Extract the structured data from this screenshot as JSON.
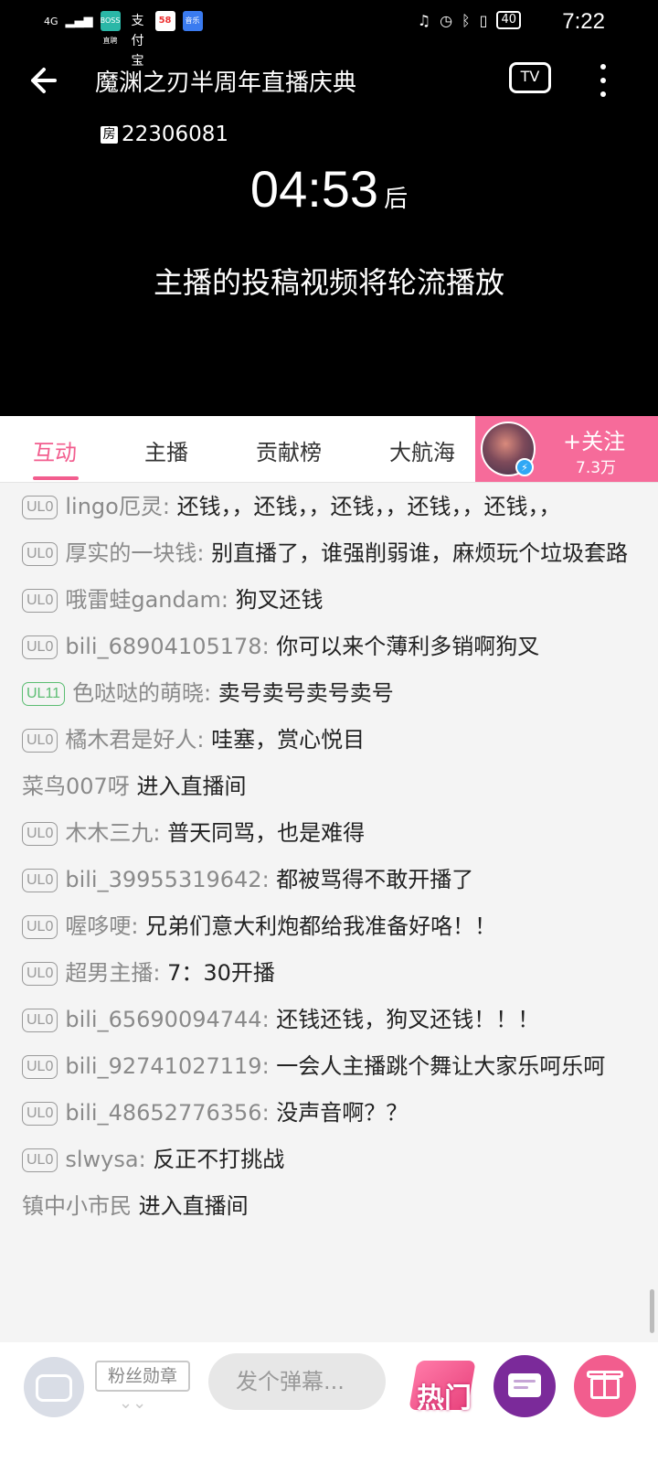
{
  "status_bar": {
    "network": "4G",
    "app_icons": [
      "BOSS直聘",
      "支付宝",
      "58",
      "音乐"
    ],
    "battery": "40",
    "time": "7:22"
  },
  "header": {
    "title": "魔渊之刃半周年直播庆典",
    "tv_label": "TV",
    "room_prefix": "房",
    "room_id": "22306081"
  },
  "player": {
    "countdown": "04:53",
    "countdown_suffix": "后",
    "notice": "主播的投稿视频将轮流播放"
  },
  "tabs": [
    {
      "label": "互动",
      "active": true
    },
    {
      "label": "主播",
      "active": false
    },
    {
      "label": "贡献榜",
      "active": false
    },
    {
      "label": "大航海",
      "active": false
    }
  ],
  "follow": {
    "label": "+关注",
    "count": "7.3万"
  },
  "chat": [
    {
      "badge": "UL0",
      "badge_color": "gray",
      "user": "lingo厄灵:",
      "text": "还钱，，还钱，，还钱，，还钱，，还钱，，"
    },
    {
      "badge": "UL0",
      "badge_color": "gray",
      "user": "厚实的一块钱:",
      "text": "别直播了，谁强削弱谁，麻烦玩个垃圾套路"
    },
    {
      "badge": "UL0",
      "badge_color": "gray",
      "user": "哦雷蛙gandam:",
      "text": "狗叉还钱"
    },
    {
      "badge": "UL0",
      "badge_color": "gray",
      "user": "bili_68904105178:",
      "text": "你可以来个薄利多销啊狗叉"
    },
    {
      "badge": "UL11",
      "badge_color": "green",
      "user": "色哒哒的萌晓:",
      "text": "卖号卖号卖号卖号"
    },
    {
      "badge": "UL0",
      "badge_color": "gray",
      "user": "橘木君是好人:",
      "text": "哇塞，赏心悦目"
    },
    {
      "badge": "",
      "badge_color": "",
      "user": "菜鸟007呀",
      "text": "进入直播间"
    },
    {
      "badge": "UL0",
      "badge_color": "gray",
      "user": "木木三九:",
      "text": "普天同骂，也是难得"
    },
    {
      "badge": "UL0",
      "badge_color": "gray",
      "user": "bili_39955319642:",
      "text": "都被骂得不敢开播了"
    },
    {
      "badge": "UL0",
      "badge_color": "gray",
      "user": "喔哆哽:",
      "text": "兄弟们意大利炮都给我准备好咯！！"
    },
    {
      "badge": "UL0",
      "badge_color": "gray",
      "user": "超男主播:",
      "text": "7：30开播"
    },
    {
      "badge": "UL0",
      "badge_color": "gray",
      "user": "bili_65690094744:",
      "text": "还钱还钱，狗叉还钱！！！"
    },
    {
      "badge": "UL0",
      "badge_color": "gray",
      "user": "bili_92741027119:",
      "text": "一会人主播跳个舞让大家乐呵乐呵"
    },
    {
      "badge": "UL0",
      "badge_color": "gray",
      "user": "bili_48652776356:",
      "text": "没声音啊？？"
    },
    {
      "badge": "UL0",
      "badge_color": "gray",
      "user": "slwysa:",
      "text": "反正不打挑战"
    },
    {
      "badge": "",
      "badge_color": "",
      "user": "镇中小市民",
      "text": "进入直播间"
    }
  ],
  "bottom_bar": {
    "medal_label": "粉丝勋章",
    "danmaku_placeholder": "发个弹幕...",
    "hot_label": "热门"
  },
  "colors": {
    "accent": "#f25d8e",
    "follow_bg": "#f66b9a",
    "badge_gray": "#9a9a9a",
    "badge_green": "#5bbd72"
  }
}
